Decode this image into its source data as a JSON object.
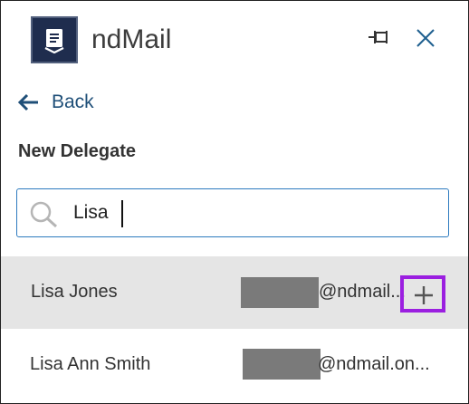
{
  "app": {
    "title": "ndMail"
  },
  "header": {
    "icons": [
      "logo-icon",
      "pin-icon",
      "close-icon"
    ]
  },
  "nav": {
    "back_label": "Back"
  },
  "section": {
    "title": "New Delegate"
  },
  "search": {
    "value": "Lisa",
    "icon": "search-icon"
  },
  "results": [
    {
      "name": "Lisa Jones",
      "email": "@ndmail...",
      "highlighted": true
    },
    {
      "name": "Lisa Ann Smith",
      "email": "@ndmail.on..."
    }
  ],
  "colors": {
    "logo_bg": "#1f2d4e",
    "accent": "#1f4f78",
    "input_border": "#2e7bbf",
    "add_highlight": "#9b1fe0",
    "row_highlight": "#e5e5e5"
  }
}
